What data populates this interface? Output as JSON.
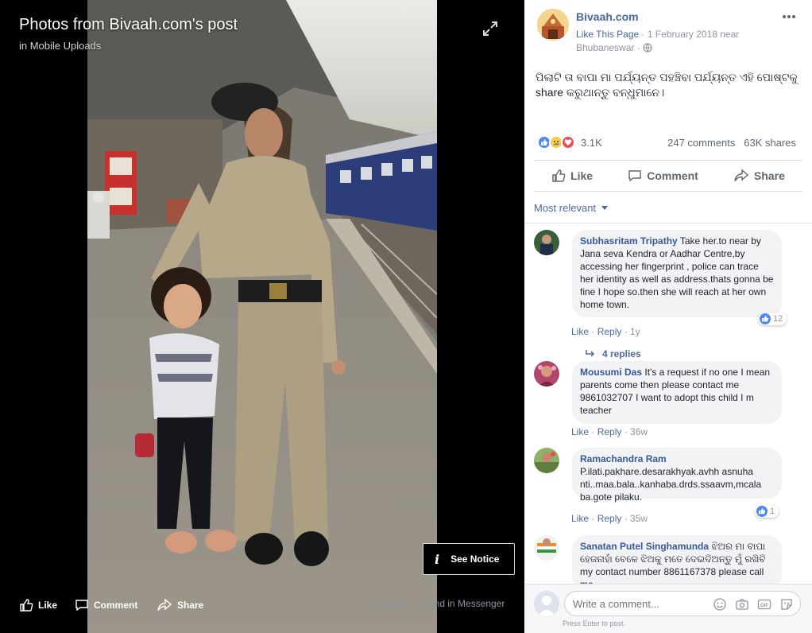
{
  "viewer": {
    "title": "Photos from Bivaah.com's post",
    "subtitle": "in Mobile Uploads",
    "see_notice": "See Notice",
    "actions": {
      "like": "Like",
      "comment": "Comment",
      "share": "Share",
      "options": "Options",
      "send": "Send in Messenger"
    }
  },
  "post": {
    "page_name": "Bivaah.com",
    "like_page": "Like This Page",
    "date": "1 February 2018 near",
    "location": "Bhubaneswar",
    "text": "ପିଲାଟି ତା ବାପା ମା ପର୍ଯ୍ୟନ୍ତ ପହଞ୍ଚିବା ପର୍ଯ୍ୟନ୍ତ ଏହି ପୋଷ୍ଟକୁ share କରୁଥାନ୍ତୁ ବନ୍ଧୁମାନେ।",
    "reaction_count": "3.1K",
    "comments_count": "247 comments",
    "shares_count": "63K shares",
    "actions": {
      "like": "Like",
      "comment": "Comment",
      "share": "Share"
    },
    "sort_label": "Most relevant"
  },
  "comments": [
    {
      "author": "Subhasritam Tripathy",
      "text": "Take her.to near by Jana seva Kendra or Aadhar Centre,by accessing her fingerprint , police can trace her identity as well as address.thats gonna be fine I hope so.then she will reach at her own home town.",
      "like": "Like",
      "reply": "Reply",
      "time": "1y",
      "likes": "12",
      "replies": "4 replies"
    },
    {
      "author": "Mousumi Das",
      "text": "It's a request if no one I mean parents come then please contact me 9861032707 I want to adopt this child I m teacher",
      "like": "Like",
      "reply": "Reply",
      "time": "36w"
    },
    {
      "author": "Ramachandra Ram",
      "text": "P.ilati.pakhare.desarakhyak.avhh asnuha nti..maa.bala..kanhaba.drds.ssaavm,mcala ba.gote pilaku.",
      "like": "Like",
      "reply": "Reply",
      "time": "35w",
      "likes": "1"
    },
    {
      "author": "Sanatan Putel Singhamunda",
      "text": "ଝିଅର ମା ବାପା ହେଜନାହାଁ ବେଳେ ଝିଅକୁ ମତେ ଦେଇଦିଅନ୍ତୁ ମୁଁ ରଖିବି my contact number 8861167378 please call me"
    }
  ],
  "composer": {
    "placeholder": "Write a comment...",
    "hint": "Press Enter to post."
  }
}
